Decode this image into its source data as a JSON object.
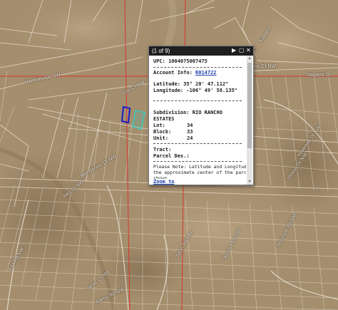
{
  "map": {
    "road_labels": [
      "Gila Ct NW",
      "Harmony Dr NW",
      "Mendocino Dr NW",
      "Nez Ct NW",
      "Nagano Ct",
      "Nagano Ct NW",
      "Nagano",
      "Vinson Dr NW",
      "Tascosa Rd NW",
      "Tennyson Rd NW",
      "Yosemite Dr NW",
      "Yeraz Ct NW",
      "Alamo Rd NW",
      "Ella Rd NW",
      "Teton Rd NW"
    ],
    "colors": {
      "terrain": "#a48e6e",
      "parcel_line": "#e8e0d4",
      "boundary_red": "#d8352e",
      "selected_parcel": "#1c1cc8",
      "adjacent_parcel": "#3ec8b8"
    }
  },
  "popup": {
    "counter": "(1 of 9)",
    "controls": {
      "next_icon": "play-icon",
      "maximize_icon": "maximize-icon",
      "close_icon": "close-icon"
    },
    "upc_label": "UPC: 1004075007475",
    "account_label": "Account Info:",
    "account_link": "R014722",
    "latitude_label": "Latitude: 35° 20' 47.112\"",
    "longitude_label": "Longitude: -106° 49' 58.135\"",
    "subdivision_label": "Subdivision: RIO RANCHO",
    "subdivision_cont": "ESTATES",
    "lot": {
      "label": "Lot:",
      "value": "34"
    },
    "block": {
      "label": "Block:",
      "value": "33"
    },
    "unit": {
      "label": "Unit:",
      "value": "24"
    },
    "tract_label": "Tract:",
    "parcel_des_label": "Parcel Des.:",
    "note_line1": "Please Note: Latitude and Longitude is",
    "note_line2": "the approximate center of the parcel",
    "note_line3": "shown.",
    "zoom_link": "Zoom to"
  }
}
